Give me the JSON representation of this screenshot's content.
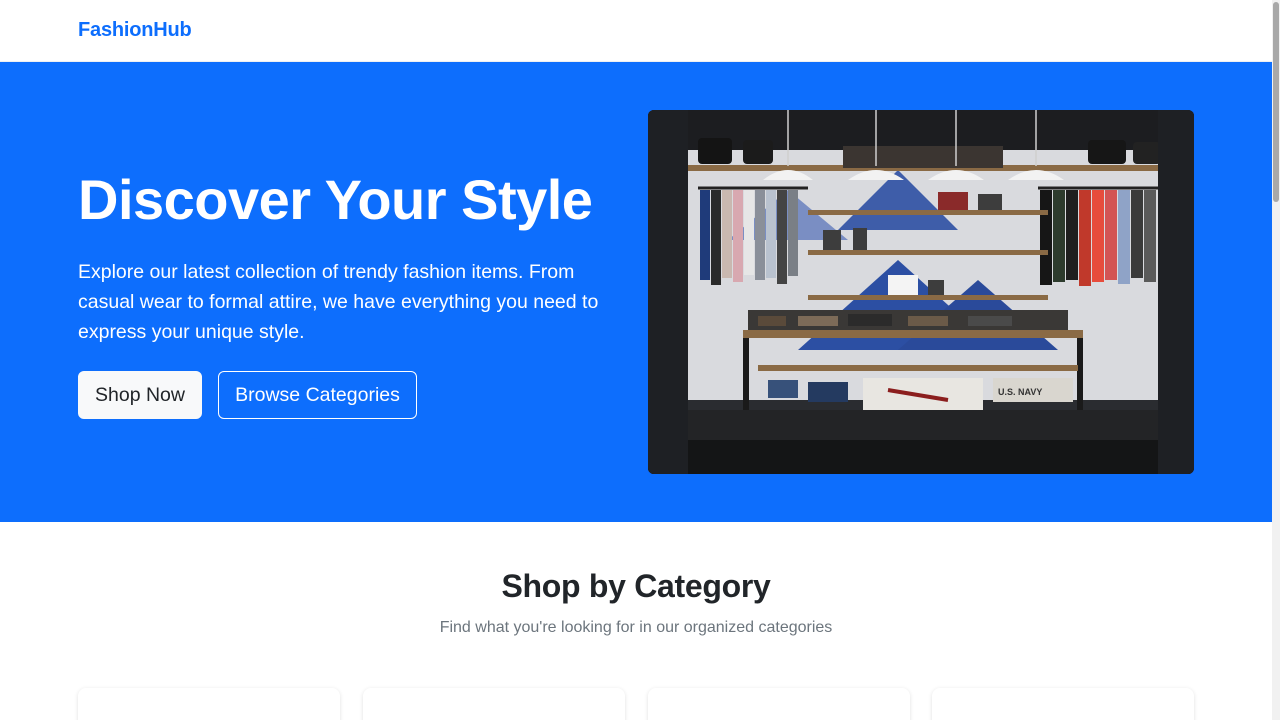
{
  "navbar": {
    "brand": "FashionHub"
  },
  "hero": {
    "title": "Discover Your Style",
    "subtitle": "Explore our latest collection of trendy fashion items. From casual wear to formal attire, we have everything you need to express your unique style.",
    "primary_button": "Shop Now",
    "secondary_button": "Browse Categories",
    "image": {
      "subject": "clothing-store-interior",
      "shelf_sign": "U.S. NAVY"
    }
  },
  "categories": {
    "title": "Shop by Category",
    "subtitle": "Find what you're looking for in our organized categories",
    "cards": [
      {},
      {},
      {},
      {}
    ]
  },
  "colors": {
    "primary": "#0d6efd",
    "light": "#f8f9fa",
    "text": "#212529",
    "muted": "#6c757d"
  }
}
